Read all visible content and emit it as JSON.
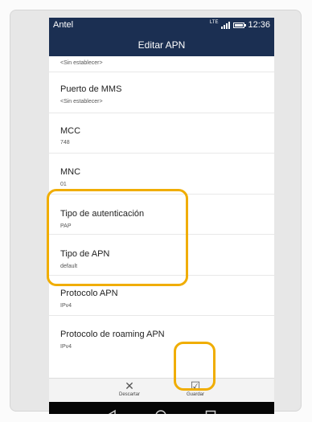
{
  "status_bar": {
    "carrier": "Antel",
    "network": "LTE",
    "time": "12:36"
  },
  "header": {
    "title": "Editar APN"
  },
  "settings": [
    {
      "label": "",
      "value": "<Sin establecer>"
    },
    {
      "label": "Puerto de MMS",
      "value": "<Sin establecer>"
    },
    {
      "label": "MCC",
      "value": "748"
    },
    {
      "label": "MNC",
      "value": "01"
    },
    {
      "label": "Tipo de autenticación",
      "value": "PAP"
    },
    {
      "label": "Tipo de APN",
      "value": "default"
    },
    {
      "label": "Protocolo APN",
      "value": "IPv4"
    },
    {
      "label": "Protocolo de roaming APN",
      "value": "IPv4"
    }
  ],
  "actions": {
    "discard_label": "Descartar",
    "save_label": "Guardar"
  },
  "icons": {
    "discard": "close-icon",
    "save": "checkbox-check-icon",
    "back": "back-triangle-icon",
    "home": "home-circle-icon",
    "recents": "recents-square-icon"
  },
  "colors": {
    "header_bg": "#1b2f52",
    "highlight": "#f0ad00"
  }
}
